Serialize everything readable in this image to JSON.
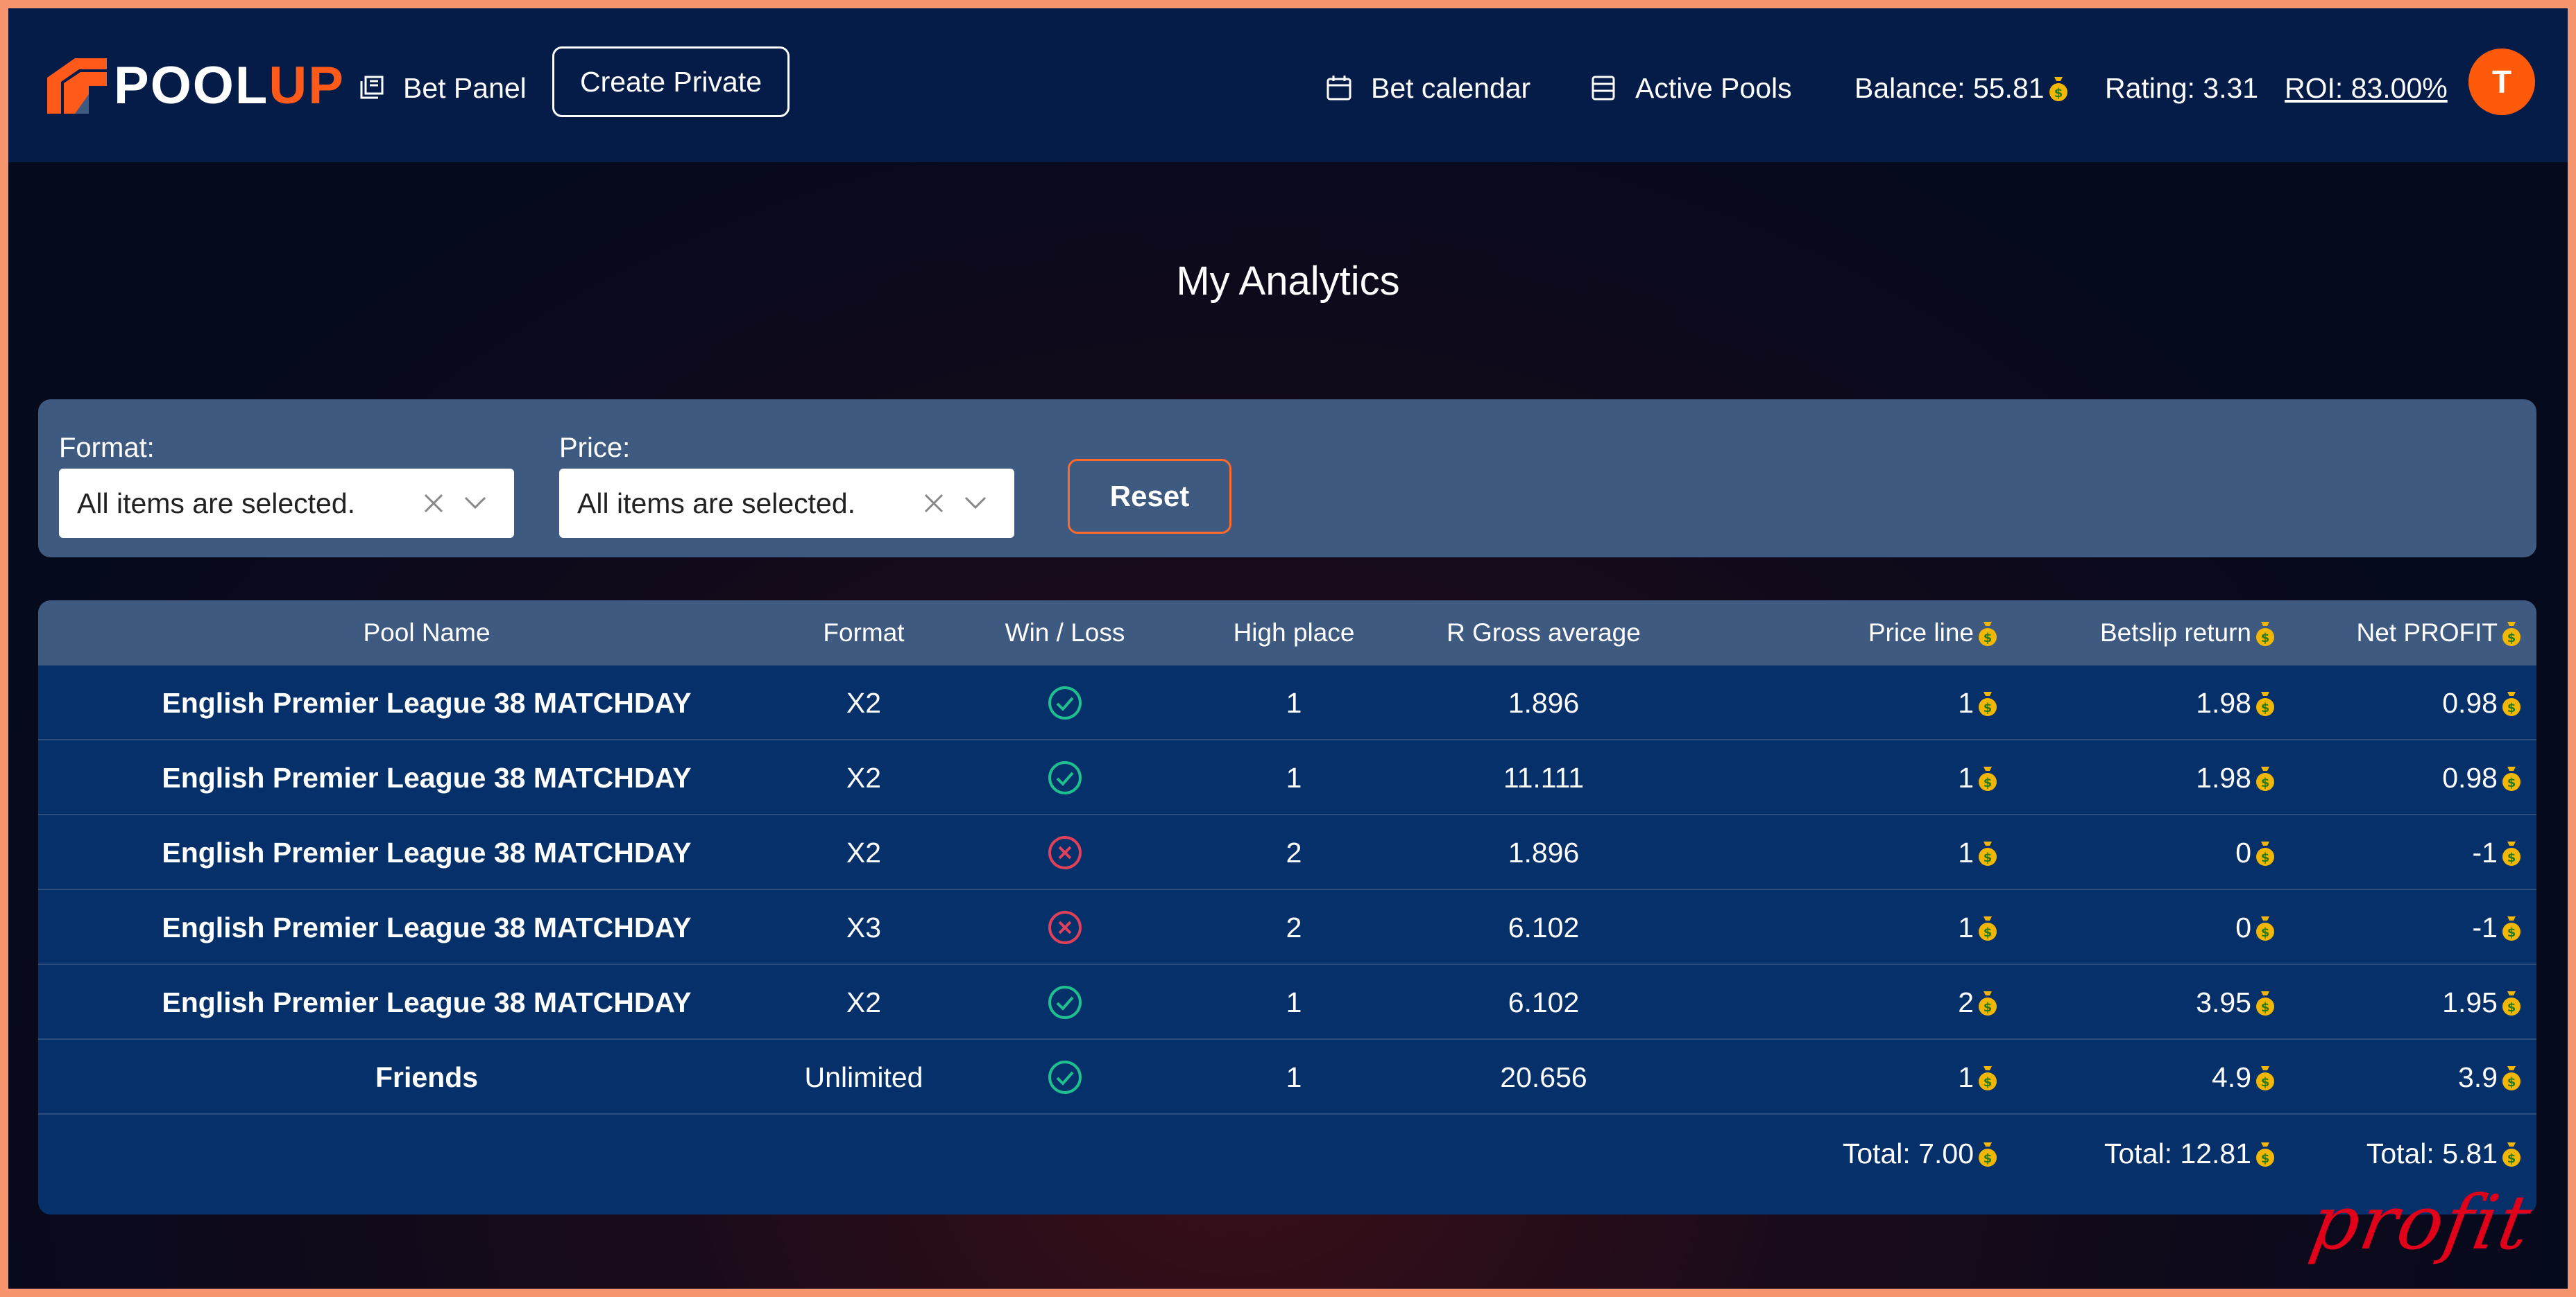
{
  "brand": {
    "pool": "POOL",
    "up": "UP"
  },
  "nav": {
    "bet_panel": "Bet Panel",
    "create_private": "Create Private",
    "bet_calendar": "Bet calendar",
    "active_pools": "Active Pools",
    "balance": "Balance: 55.81",
    "rating": "Rating: 3.31",
    "roi": "ROI: 83.00%",
    "avatar_initial": "T"
  },
  "page": {
    "title": "My Analytics"
  },
  "filters": {
    "format_label": "Format:",
    "format_value": "All items are selected.",
    "price_label": "Price:",
    "price_value": "All items are selected.",
    "reset_label": "Reset"
  },
  "table": {
    "headers": {
      "pool_name": "Pool Name",
      "format": "Format",
      "win_loss": "Win / Loss",
      "high_place": "High place",
      "gross_avg": "R Gross average",
      "price_line": "Price line",
      "betslip_return": "Betslip return",
      "net_profit": "Net PROFIT"
    },
    "rows": [
      {
        "name": "English Premier League 38 MATCHDAY",
        "format": "X2",
        "result": "win",
        "high_place": "1",
        "gross_avg": "1.896",
        "price_line": "1",
        "betslip_return": "1.98",
        "net_profit": "0.98"
      },
      {
        "name": "English Premier League 38 MATCHDAY",
        "format": "X2",
        "result": "win",
        "high_place": "1",
        "gross_avg": "11.111",
        "price_line": "1",
        "betslip_return": "1.98",
        "net_profit": "0.98"
      },
      {
        "name": "English Premier League 38 MATCHDAY",
        "format": "X2",
        "result": "loss",
        "high_place": "2",
        "gross_avg": "1.896",
        "price_line": "1",
        "betslip_return": "0",
        "net_profit": "-1"
      },
      {
        "name": "English Premier League 38 MATCHDAY",
        "format": "X3",
        "result": "loss",
        "high_place": "2",
        "gross_avg": "6.102",
        "price_line": "1",
        "betslip_return": "0",
        "net_profit": "-1"
      },
      {
        "name": "English Premier League 38 MATCHDAY",
        "format": "X2",
        "result": "win",
        "high_place": "1",
        "gross_avg": "6.102",
        "price_line": "2",
        "betslip_return": "3.95",
        "net_profit": "1.95"
      },
      {
        "name": "Friends",
        "format": "Unlimited",
        "result": "win",
        "high_place": "1",
        "gross_avg": "20.656",
        "price_line": "1",
        "betslip_return": "4.9",
        "net_profit": "3.9"
      }
    ],
    "totals": {
      "price_line": "Total: 7.00",
      "betslip_return": "Total: 12.81",
      "net_profit": "Total: 5.81"
    }
  },
  "watermark": "profit",
  "colors": {
    "accent": "#ff5a1a",
    "nav_bg": "#041c47",
    "panel_bg": "#3e5a80",
    "table_bg": "#05306a",
    "win": "#1fbf8f",
    "loss": "#e0405a",
    "coin": "#f2b705"
  },
  "icons": {
    "bet_panel": "layers-icon",
    "bet_calendar": "calendar-icon",
    "active_pools": "list-icon",
    "currency": "coin-bag-icon",
    "win": "check-circle-icon",
    "loss": "x-circle-icon"
  }
}
